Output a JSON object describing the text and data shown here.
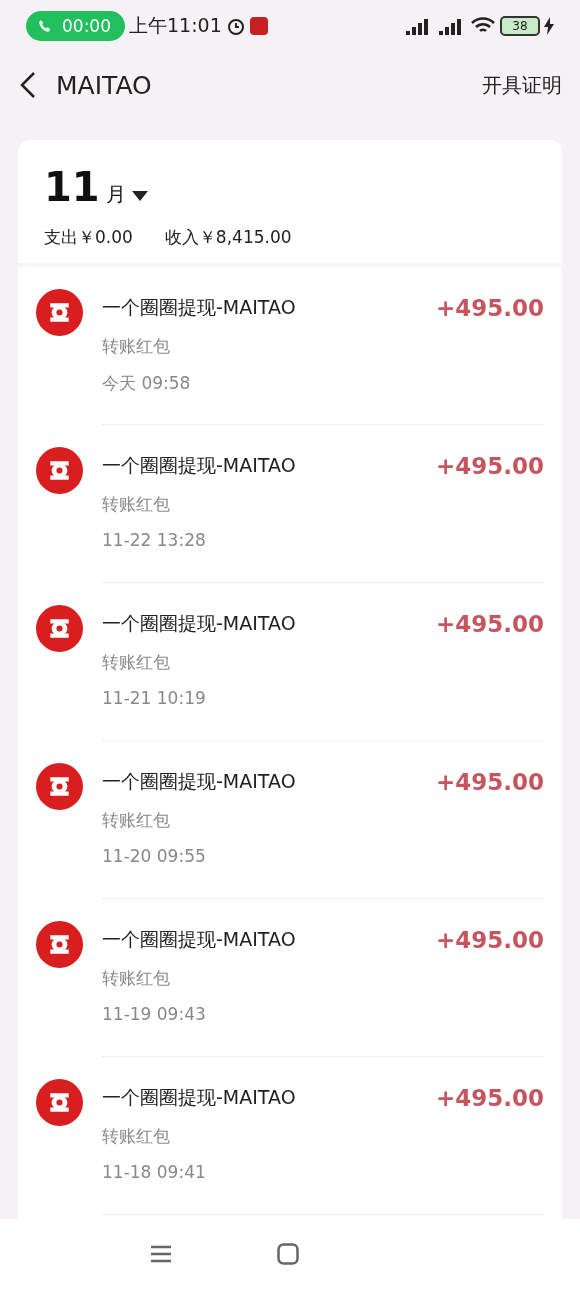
{
  "status_bar": {
    "call_timer": "00:00",
    "time": "上午11:01",
    "battery": "38"
  },
  "header": {
    "title": "MAITAO",
    "action": "开具证明"
  },
  "summary": {
    "month": "11",
    "month_unit": "月",
    "expense": "支出￥0.00",
    "income": "收入￥8,415.00"
  },
  "transactions": [
    {
      "title": "一个圈圈提现-MAITAO",
      "type": "转账红包",
      "time": "今天 09:58",
      "amount": "+495.00"
    },
    {
      "title": "一个圈圈提现-MAITAO",
      "type": "转账红包",
      "time": "11-22 13:28",
      "amount": "+495.00"
    },
    {
      "title": "一个圈圈提现-MAITAO",
      "type": "转账红包",
      "time": "11-21 10:19",
      "amount": "+495.00"
    },
    {
      "title": "一个圈圈提现-MAITAO",
      "type": "转账红包",
      "time": "11-20 09:55",
      "amount": "+495.00"
    },
    {
      "title": "一个圈圈提现-MAITAO",
      "type": "转账红包",
      "time": "11-19 09:43",
      "amount": "+495.00"
    },
    {
      "title": "一个圈圈提现-MAITAO",
      "type": "转账红包",
      "time": "11-18 09:41",
      "amount": "+495.00"
    }
  ]
}
